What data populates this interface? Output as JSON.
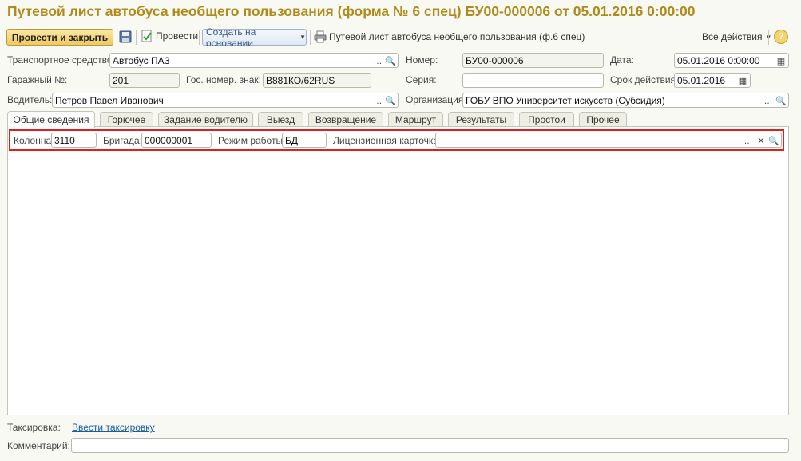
{
  "title": "Путевой лист автобуса необщего пользования (форма № 6 спец) БУ00-000006 от 05.01.2016 0:00:00",
  "toolbar": {
    "post_close": "Провести и закрыть",
    "post": "Провести",
    "create_based": "Создать на основании",
    "print": "Путевой лист автобуса необщего пользования (ф.6 спец)",
    "all_actions": "Все действия",
    "help": "?"
  },
  "fields": {
    "vehicle": {
      "label": "Транспортное средство:",
      "value": "Автобус ПАЗ"
    },
    "number": {
      "label": "Номер:",
      "value": "БУ00-000006"
    },
    "date": {
      "label": "Дата:",
      "value": "05.01.2016  0:00:00"
    },
    "garage": {
      "label": "Гаражный №:",
      "value": "201"
    },
    "plate": {
      "label": "Гос. номер. знак:",
      "value": "В881КО/62RUS"
    },
    "series": {
      "label": "Серия:",
      "value": ""
    },
    "validity": {
      "label": "Срок действия:",
      "value": "05.01.2016"
    },
    "driver": {
      "label": "Водитель:",
      "value": "Петров Павел Иванович"
    },
    "org": {
      "label": "Организация:",
      "value": "ГОБУ ВПО Университет искусств (Субсидия)"
    }
  },
  "tabs": [
    {
      "label": "Общие сведения"
    },
    {
      "label": "Горючее"
    },
    {
      "label": "Задание водителю"
    },
    {
      "label": "Выезд"
    },
    {
      "label": "Возвращение"
    },
    {
      "label": "Маршрут"
    },
    {
      "label": "Результаты"
    },
    {
      "label": "Простои"
    },
    {
      "label": "Прочее"
    }
  ],
  "general": {
    "column": {
      "label": "Колонна:",
      "value": "3110"
    },
    "brigade": {
      "label": "Бригада:",
      "value": "000000001"
    },
    "mode": {
      "label": "Режим работы:",
      "value": "БД"
    },
    "license": {
      "label": "Лицензионная карточка:",
      "value": ""
    }
  },
  "footer": {
    "taxation_label": "Таксировка:",
    "taxation_link": "Ввести таксировку",
    "comment_label": "Комментарий:",
    "comment_value": ""
  },
  "colors": {
    "title": "#b08a1a",
    "primary_button": "#f0c95e",
    "highlight": "#e01e1e",
    "link": "#1b5ca8"
  },
  "icons": [
    "save-icon",
    "post-icon",
    "print-icon",
    "select-icon",
    "search-icon",
    "calendar-icon",
    "clear-icon",
    "help-icon"
  ]
}
